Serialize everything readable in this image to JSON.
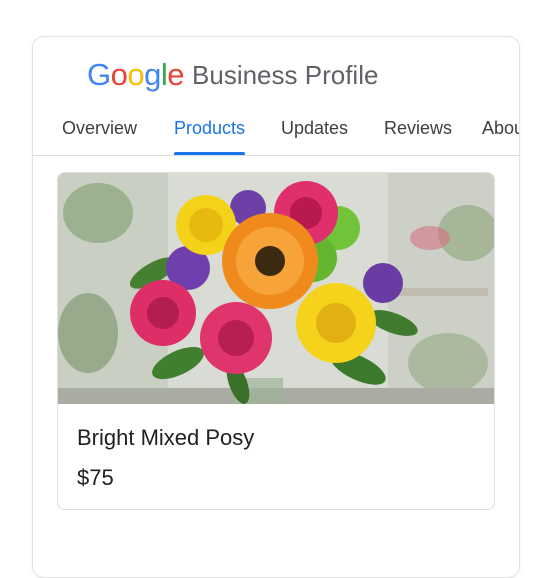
{
  "brand": {
    "logo_letters": [
      {
        "char": "G",
        "color": "#4285F4"
      },
      {
        "char": "o",
        "color": "#EA4335"
      },
      {
        "char": "o",
        "color": "#FBBC05"
      },
      {
        "char": "g",
        "color": "#4285F4"
      },
      {
        "char": "l",
        "color": "#34A853"
      },
      {
        "char": "e",
        "color": "#EA4335"
      }
    ],
    "product_name": "Business Profile"
  },
  "tabs": [
    {
      "label": "Overview",
      "active": false
    },
    {
      "label": "Products",
      "active": true
    },
    {
      "label": "Updates",
      "active": false
    },
    {
      "label": "Reviews",
      "active": false
    },
    {
      "label": "About",
      "active": false
    }
  ],
  "product": {
    "title": "Bright Mixed Posy",
    "price": "$75"
  },
  "colors": {
    "accent": "#1a73e8"
  }
}
